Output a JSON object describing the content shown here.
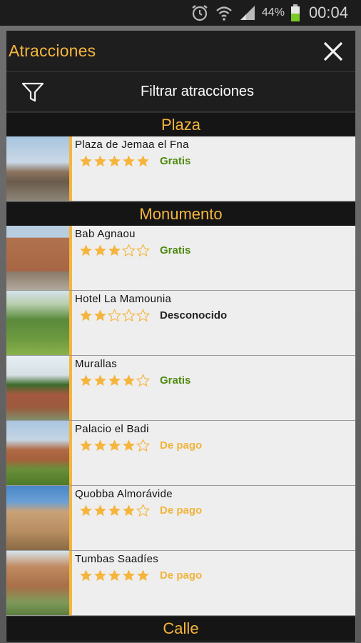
{
  "status_bar": {
    "battery_percent": "44%",
    "time": "00:04",
    "icons": [
      "alarm-icon",
      "wifi-icon",
      "signal-icon",
      "battery-icon"
    ]
  },
  "dialog": {
    "title": "Atracciones",
    "filter_label": "Filtrar atracciones"
  },
  "colors": {
    "accent": "#f5b53d",
    "free": "#4f8a10",
    "paid": "#f0b43c",
    "unknown": "#222222"
  },
  "sections": [
    {
      "title": "Plaza",
      "items": [
        {
          "name": "Plaza de Jemaa el Fna",
          "rating": 5,
          "price": "Gratis",
          "price_type": "free"
        }
      ]
    },
    {
      "title": "Monumento",
      "items": [
        {
          "name": "Bab Agnaou",
          "rating": 3,
          "price": "Gratis",
          "price_type": "free"
        },
        {
          "name": "Hotel La Mamounia",
          "rating": 2,
          "price": "Desconocido",
          "price_type": "unknown"
        },
        {
          "name": "Murallas",
          "rating": 4,
          "price": "Gratis",
          "price_type": "free"
        },
        {
          "name": "Palacio el Badi",
          "rating": 4,
          "price": "De pago",
          "price_type": "paid"
        },
        {
          "name": "Quobba Almorávide",
          "rating": 4,
          "price": "De pago",
          "price_type": "paid"
        },
        {
          "name": "Tumbas Saadíes",
          "rating": 5,
          "price": "De pago",
          "price_type": "paid"
        }
      ]
    },
    {
      "title": "Calle",
      "items": []
    }
  ]
}
